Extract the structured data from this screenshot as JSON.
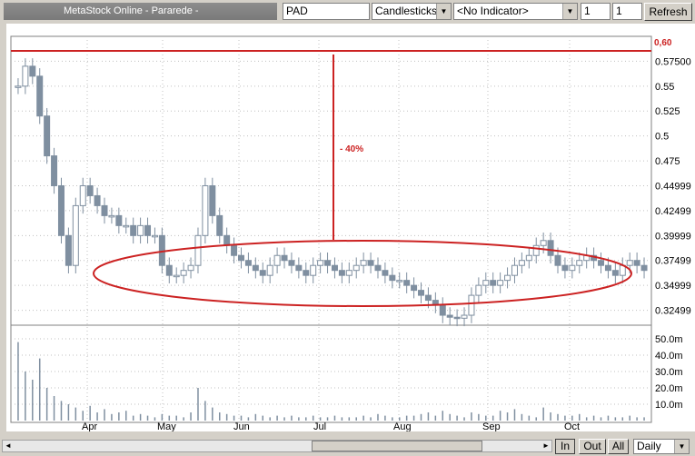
{
  "toolbar": {
    "app_title": "MetaStock Online - Pararede -",
    "symbol": "PAD",
    "chart_style": "Candlesticks",
    "indicator": "<No Indicator>",
    "field1": "1",
    "field2": "1",
    "refresh_label": "Refresh"
  },
  "bottom": {
    "in_label": "In",
    "out_label": "Out",
    "all_label": "All",
    "period": "Daily"
  },
  "annotations": {
    "resistance_label": "0,60",
    "drop_label": "- 40%"
  },
  "colors": {
    "candle": "#7f8fa0",
    "annotation": "#cc2222",
    "grid": "#c0c0c0"
  },
  "chart_data": {
    "type": "candlestick",
    "x_months": [
      "Apr",
      "May",
      "Jun",
      "Jul",
      "Aug",
      "Sep",
      "Oct"
    ],
    "y_ticks": [
      "0.57500",
      "0.55",
      "0.525",
      "0.5",
      "0.475",
      "0.44999",
      "0.42499",
      "0.39999",
      "0.37499",
      "0.34999",
      "0.32499"
    ],
    "ylim": [
      0.31,
      0.6
    ],
    "volume_ticks": [
      "50.0m",
      "40.0m",
      "30.0m",
      "20.0m",
      "10.0m"
    ],
    "volume_ylim": [
      0,
      55
    ],
    "close_approx": [
      0.55,
      0.57,
      0.56,
      0.52,
      0.48,
      0.45,
      0.4,
      0.37,
      0.43,
      0.45,
      0.44,
      0.43,
      0.42,
      0.42,
      0.41,
      0.41,
      0.4,
      0.41,
      0.4,
      0.4,
      0.37,
      0.36,
      0.36,
      0.365,
      0.37,
      0.4,
      0.45,
      0.42,
      0.4,
      0.39,
      0.38,
      0.375,
      0.37,
      0.365,
      0.36,
      0.37,
      0.38,
      0.375,
      0.37,
      0.365,
      0.36,
      0.37,
      0.375,
      0.37,
      0.365,
      0.36,
      0.365,
      0.37,
      0.375,
      0.37,
      0.365,
      0.36,
      0.355,
      0.355,
      0.35,
      0.345,
      0.34,
      0.335,
      0.33,
      0.32,
      0.318,
      0.317,
      0.32,
      0.34,
      0.35,
      0.355,
      0.35,
      0.355,
      0.36,
      0.37,
      0.375,
      0.38,
      0.39,
      0.395,
      0.38,
      0.37,
      0.365,
      0.37,
      0.375,
      0.38,
      0.375,
      0.37,
      0.365,
      0.36,
      0.37,
      0.375,
      0.37,
      0.365
    ],
    "volume_approx": [
      48,
      30,
      25,
      38,
      20,
      15,
      12,
      10,
      8,
      6,
      9,
      5,
      7,
      4,
      5,
      6,
      3,
      4,
      3,
      2,
      4,
      3,
      3,
      2,
      5,
      20,
      12,
      8,
      5,
      4,
      3,
      3,
      2,
      4,
      3,
      2,
      3,
      2,
      3,
      2,
      2,
      3,
      2,
      2,
      3,
      2,
      2,
      2,
      3,
      2,
      4,
      3,
      2,
      2,
      3,
      3,
      4,
      5,
      3,
      6,
      4,
      3,
      2,
      5,
      4,
      3,
      3,
      6,
      5,
      7,
      4,
      3,
      2,
      8,
      5,
      4,
      3,
      3,
      4,
      2,
      3,
      2,
      3,
      2,
      2,
      3,
      2,
      2
    ]
  }
}
